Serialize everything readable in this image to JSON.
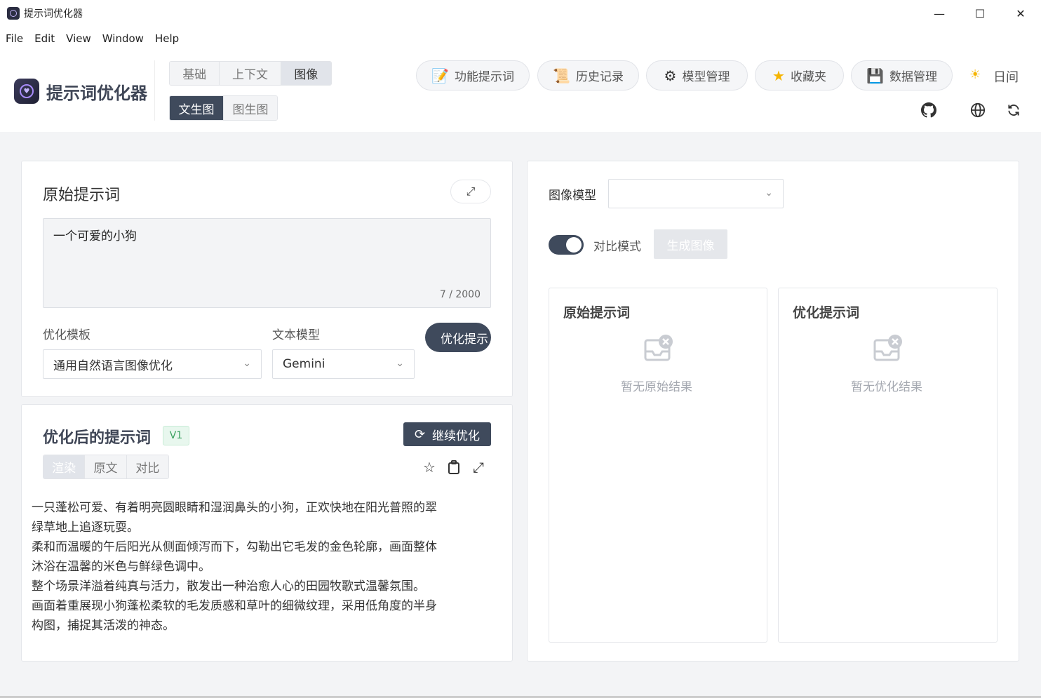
{
  "window": {
    "title": "提示词优化器"
  },
  "menu": [
    "File",
    "Edit",
    "View",
    "Window",
    "Help"
  ],
  "header": {
    "brand": "提示词优化器",
    "mode_tabs": [
      "基础",
      "上下文",
      "图像"
    ],
    "sub_tabs": [
      "文生图",
      "图生图"
    ],
    "tools": {
      "func_prompt": "功能提示词",
      "history": "历史记录",
      "model_mgmt": "模型管理",
      "favorites": "收藏夹",
      "data_mgmt": "数据管理"
    },
    "theme_label": "日间"
  },
  "original": {
    "title": "原始提示词",
    "text": "一个可爱的小狗",
    "count": "7 / 2000",
    "template_label": "优化模板",
    "template_value": "通用自然语言图像优化",
    "model_label": "文本模型",
    "model_value": "Gemini",
    "optimize_button": "优化提示"
  },
  "optimized": {
    "title": "优化后的提示词",
    "version": "V1",
    "continue_button": "继续优化",
    "view_tabs": [
      "渲染",
      "原文",
      "对比"
    ],
    "lines": [
      "一只蓬松可爱、有着明亮圆眼睛和湿润鼻头的小狗，正欢快地在阳光普照的翠",
      "绿草地上追逐玩耍。",
      "柔和而温暖的午后阳光从侧面倾泻而下，勾勒出它毛发的金色轮廓，画面整体",
      "沐浴在温馨的米色与鲜绿色调中。",
      "整个场景洋溢着纯真与活力，散发出一种治愈人心的田园牧歌式温馨氛围。",
      "画面着重展现小狗蓬松柔软的毛发质感和草叶的细微纹理，采用低角度的半身",
      "构图，捕捉其活泼的神态。"
    ]
  },
  "image_panel": {
    "model_label": "图像模型",
    "model_value": "",
    "compare_label": "对比模式",
    "generate_button": "生成图像",
    "original_card": {
      "title": "原始提示词",
      "empty": "暂无原始结果"
    },
    "optimized_card": {
      "title": "优化提示词",
      "empty": "暂无优化结果"
    }
  },
  "colors": {
    "accent_dark": "#3f4a5c",
    "version_green": "#3aa05f",
    "sun": "#f5b400"
  }
}
